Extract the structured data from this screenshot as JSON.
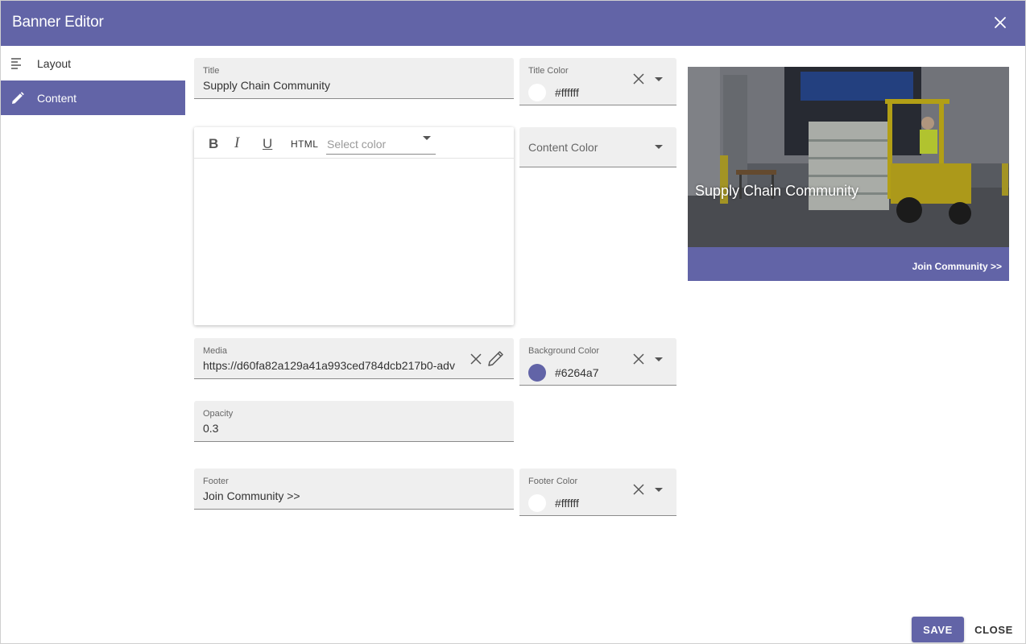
{
  "dialog": {
    "title": "Banner Editor",
    "close_icon": "close-icon"
  },
  "sidebar": {
    "items": [
      {
        "label": "Layout",
        "icon": "align-left-icon",
        "active": false
      },
      {
        "label": "Content",
        "icon": "pencil-icon",
        "active": true
      }
    ]
  },
  "form": {
    "title": {
      "label": "Title",
      "value": "Supply Chain Community"
    },
    "title_color": {
      "label": "Title Color",
      "value": "#ffffff",
      "swatch": "#ffffff"
    },
    "content_color": {
      "placeholder": "Content Color"
    },
    "editor": {
      "bold": "B",
      "italic": "I",
      "underline": "U",
      "html": "HTML",
      "color_placeholder": "Select color",
      "body": ""
    },
    "media": {
      "label": "Media",
      "value": "https://d60fa82a129a41a993ced784dcb217b0-adv"
    },
    "background_color": {
      "label": "Background Color",
      "value": "#6264a7",
      "swatch": "#6264a7"
    },
    "opacity": {
      "label": "Opacity",
      "value": "0.3"
    },
    "footer": {
      "label": "Footer",
      "value": "Join Community >>"
    },
    "footer_color": {
      "label": "Footer Color",
      "value": "#ffffff",
      "swatch": "#ffffff"
    }
  },
  "preview": {
    "title": "Supply Chain Community",
    "footer": "Join Community >>",
    "footer_bg": "#6264a7"
  },
  "actions": {
    "save": "SAVE",
    "close": "CLOSE"
  },
  "colors": {
    "accent": "#6264a7"
  }
}
